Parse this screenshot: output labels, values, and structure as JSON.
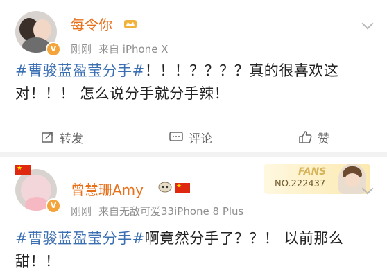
{
  "post1": {
    "user": "每令你",
    "time": "刚刚",
    "source": "来自 iPhone X",
    "hashtag": "#曹骏蓝盈莹分手#",
    "body": "！！！？？？？真的很喜欢这对！！！ 怎么说分手就分手辣！",
    "actions": {
      "repost": "转发",
      "comment": "评论",
      "like": "赞"
    }
  },
  "post2": {
    "user": "曾慧珊Amy",
    "time": "刚刚",
    "source": "来自无敌可爱33iPhone 8 Plus",
    "hashtag": "#曹骏蓝盈莹分手#",
    "body": "啊竟然分手了？？！ 以前那么甜！！",
    "fans_label": "FANS",
    "fans_no": "NO.222437"
  },
  "colors": {
    "username": "#e8701a",
    "hashtag": "#3b6fb3",
    "meta": "#8f8f8f"
  },
  "icons": [
    "chevron-down-icon",
    "repost-icon",
    "comment-icon",
    "like-icon",
    "verified-icon",
    "vip-crown-icon",
    "china-flag-icon",
    "sheep-icon"
  ]
}
